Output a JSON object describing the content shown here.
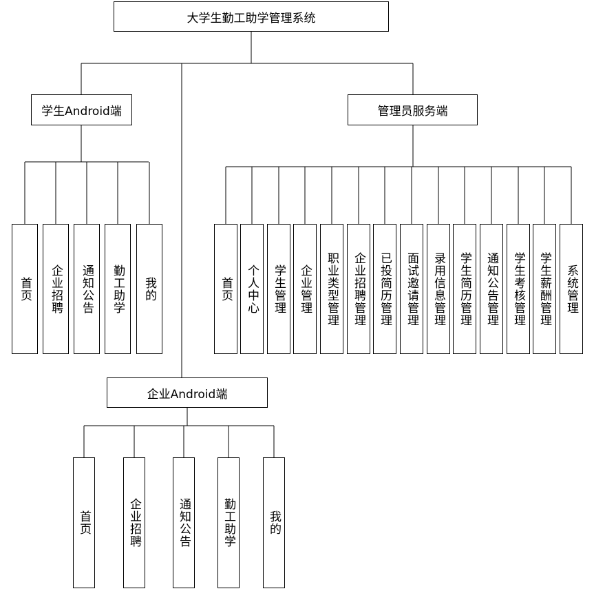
{
  "root": {
    "label": "大学生勤工助学管理系统"
  },
  "student_app": {
    "label": "学生Android端",
    "children": [
      "首页",
      "企业招聘",
      "通知公告",
      "勤工助学",
      "我的"
    ]
  },
  "admin_service": {
    "label": "管理员服务端",
    "children": [
      "首页",
      "个人中心",
      "学生管理",
      "企业管理",
      "职业类型管理",
      "企业招聘管理",
      "已投简历管理",
      "面试邀请管理",
      "录用信息管理",
      "学生简历管理",
      "通知公告管理",
      "学生考核管理",
      "学生薪酬管理",
      "系统管理"
    ]
  },
  "company_app": {
    "label": "企业Android端",
    "children": [
      "首页",
      "企业招聘",
      "通知公告",
      "勤工助学",
      "我的"
    ]
  }
}
